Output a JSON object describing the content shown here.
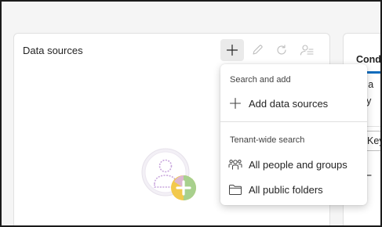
{
  "data_sources_panel": {
    "title": "Data sources",
    "toolbar": {
      "add_icon": "plus-icon",
      "edit_icon": "pencil-icon",
      "refresh_icon": "refresh-icon",
      "manage_icon": "person-search-icon"
    },
    "empty_state_icon": "add-person-icon"
  },
  "conditions_panel": {
    "tab_title": "Cond",
    "text_line_1": "ld a",
    "text_line_2": "ery",
    "input_value": "Key",
    "accent_color": "#0f6cbd"
  },
  "add_menu": {
    "section_1_header": "Search and add",
    "add_data_sources_label": "Add data sources",
    "section_2_header": "Tenant-wide search",
    "all_people_label": "All people and groups",
    "all_folders_label": "All public folders"
  }
}
